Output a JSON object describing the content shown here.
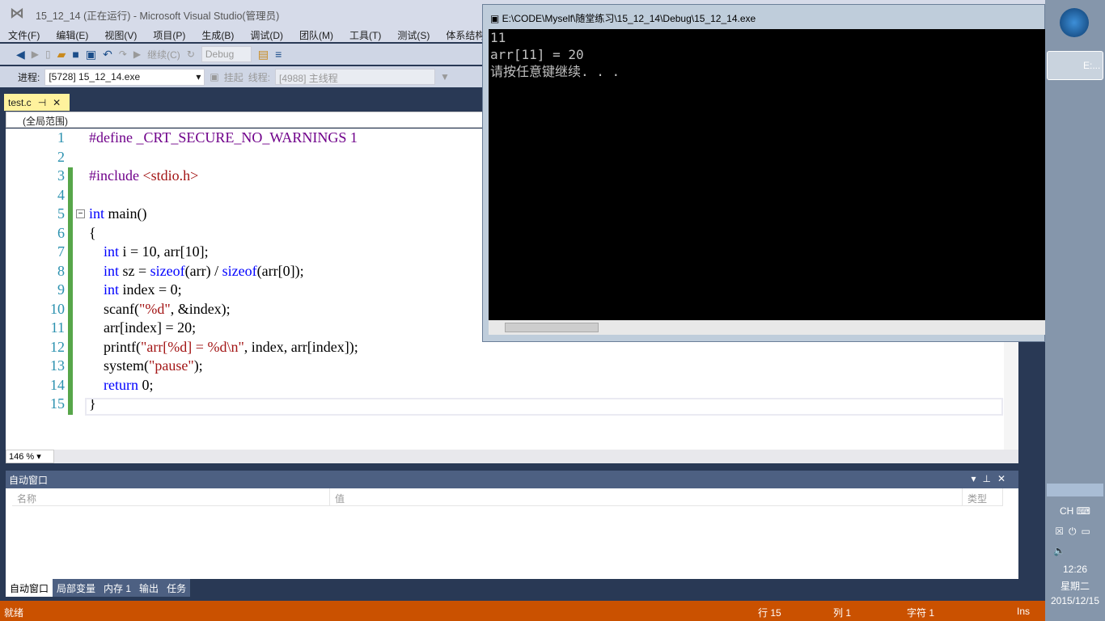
{
  "window": {
    "title": "15_12_14 (正在运行) - Microsoft Visual Studio(管理员)"
  },
  "menu": [
    "文件(F)",
    "编辑(E)",
    "视图(V)",
    "项目(P)",
    "生成(B)",
    "调试(D)",
    "团队(M)",
    "工具(T)",
    "测试(S)",
    "体系结构"
  ],
  "toolbar": {
    "continue": "继续(C)",
    "config": "Debug",
    "process_label": "进程:",
    "process": "[5728] 15_12_14.exe",
    "suspend": "挂起",
    "thread_label": "线程:",
    "thread": "[4988] 主线程"
  },
  "tab": {
    "label": "test.c"
  },
  "navbar": {
    "scope": "(全局范围)"
  },
  "editor": {
    "zoom": "146 %",
    "lines": [
      [
        {
          "t": "#define _CRT_SECURE_NO_WARNINGS 1",
          "c": "pp"
        }
      ],
      [],
      [
        {
          "t": "#include ",
          "c": "pp"
        },
        {
          "t": "<stdio.h>",
          "c": "inc"
        }
      ],
      [],
      [
        {
          "t": "int",
          "c": "kw"
        },
        {
          "t": " main()",
          "c": ""
        }
      ],
      [
        {
          "t": "{",
          "c": ""
        }
      ],
      [
        {
          "t": "    ",
          "c": ""
        },
        {
          "t": "int",
          "c": "kw"
        },
        {
          "t": " i = 10, arr[10];",
          "c": ""
        }
      ],
      [
        {
          "t": "    ",
          "c": ""
        },
        {
          "t": "int",
          "c": "kw"
        },
        {
          "t": " sz = ",
          "c": ""
        },
        {
          "t": "sizeof",
          "c": "kw"
        },
        {
          "t": "(arr) / ",
          "c": ""
        },
        {
          "t": "sizeof",
          "c": "kw"
        },
        {
          "t": "(arr[0]);",
          "c": ""
        }
      ],
      [
        {
          "t": "    ",
          "c": ""
        },
        {
          "t": "int",
          "c": "kw"
        },
        {
          "t": " index = 0;",
          "c": ""
        }
      ],
      [
        {
          "t": "    scanf(",
          "c": ""
        },
        {
          "t": "\"%d\"",
          "c": "str"
        },
        {
          "t": ", &index);",
          "c": ""
        }
      ],
      [
        {
          "t": "    arr[index] = 20;",
          "c": ""
        }
      ],
      [
        {
          "t": "    printf(",
          "c": ""
        },
        {
          "t": "\"arr[%d] = %d\\n\"",
          "c": "str"
        },
        {
          "t": ", index, arr[index]);",
          "c": ""
        }
      ],
      [
        {
          "t": "    system(",
          "c": ""
        },
        {
          "t": "\"pause\"",
          "c": "str"
        },
        {
          "t": ");",
          "c": ""
        }
      ],
      [
        {
          "t": "    ",
          "c": ""
        },
        {
          "t": "return",
          "c": "kw"
        },
        {
          "t": " 0;",
          "c": ""
        }
      ],
      [
        {
          "t": "}",
          "c": ""
        }
      ]
    ]
  },
  "autos": {
    "title": "自动窗口",
    "columns": [
      "名称",
      "值",
      "类型"
    ]
  },
  "bottom_tabs": [
    "自动窗口",
    "局部变量",
    "内存 1",
    "输出",
    "任务"
  ],
  "status": {
    "ready": "就绪",
    "line": "行 15",
    "col": "列 1",
    "char": "字符 1",
    "mode": "Ins"
  },
  "console": {
    "title": "E:\\CODE\\Myself\\随堂练习\\15_12_14\\Debug\\15_12_14.exe",
    "output": "11\narr[11] = 20\n请按任意键继续. . ."
  },
  "taskbar": {
    "item": "E:...",
    "lang": "CH",
    "time": "12:26",
    "weekday": "星期二",
    "date": "2015/12/15"
  }
}
